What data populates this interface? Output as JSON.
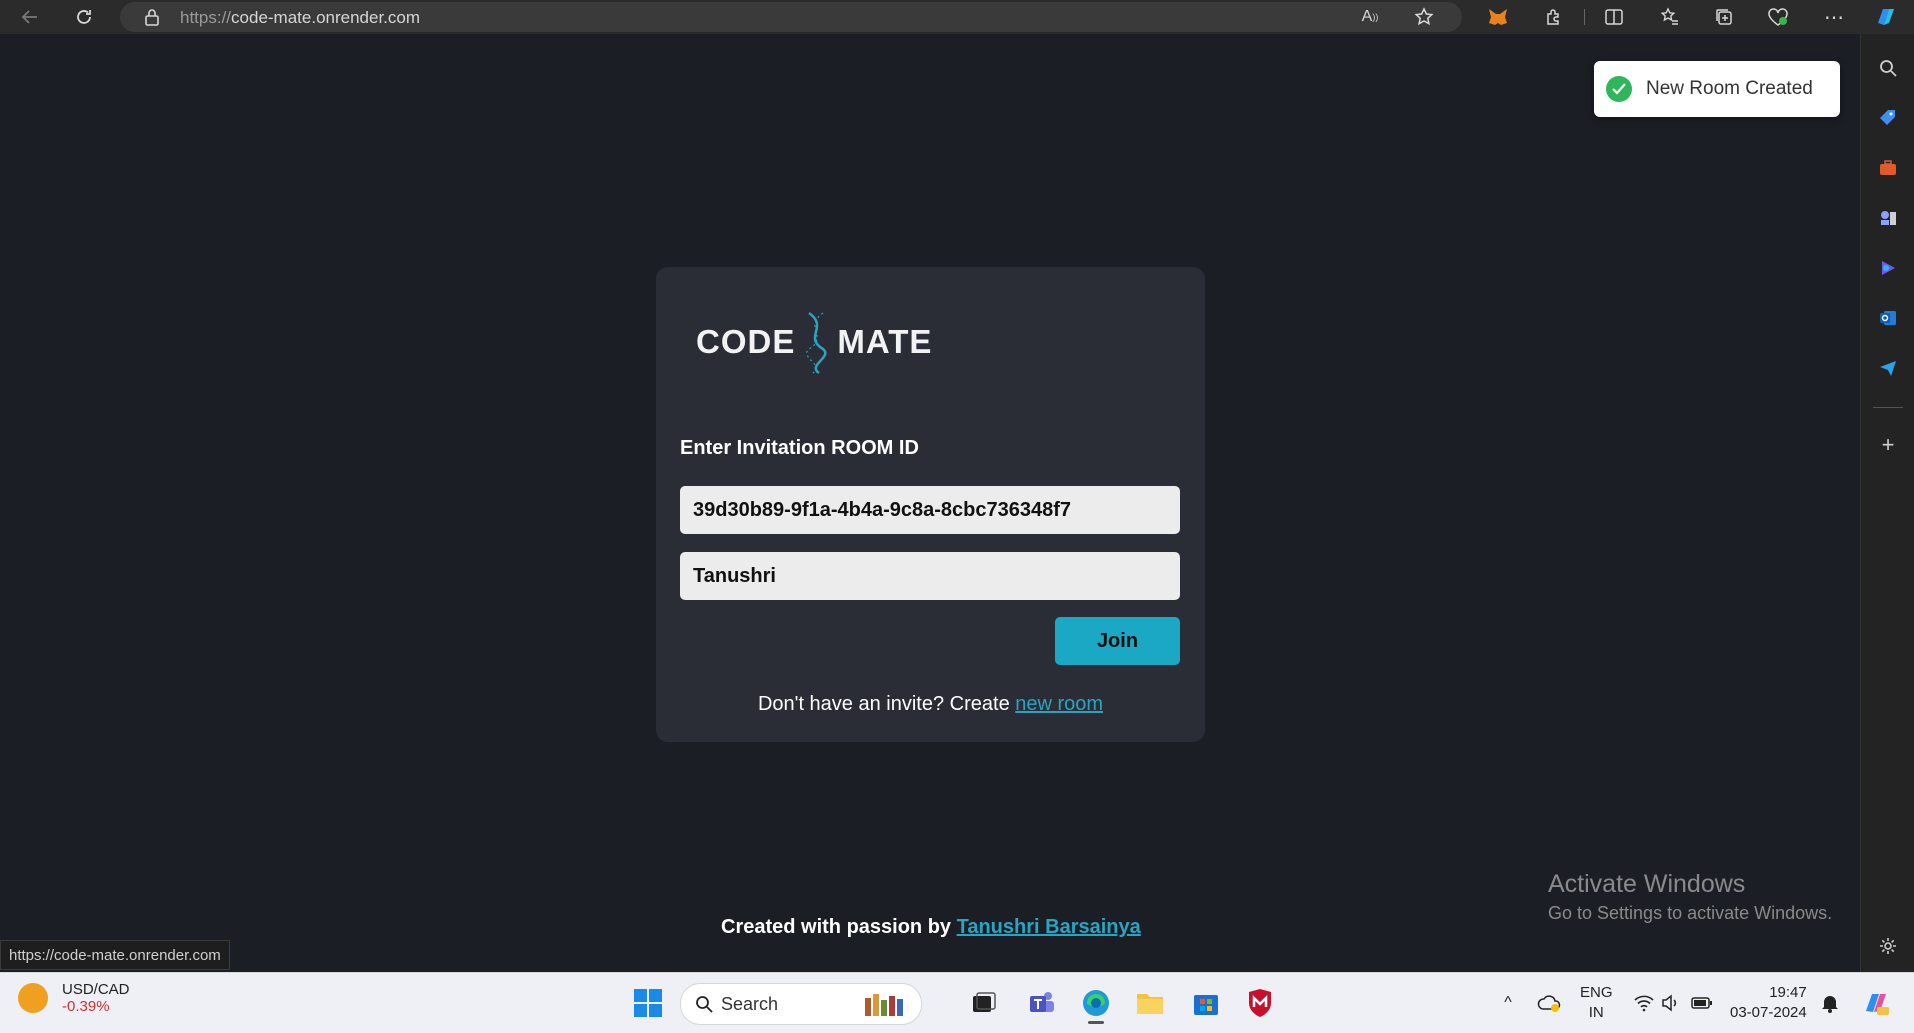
{
  "browser": {
    "url_prefix": "https://",
    "url_domain": "code-mate.onrender.com"
  },
  "toast": {
    "text": "New Room Created"
  },
  "card": {
    "logo_left": "CODE",
    "logo_right": "MATE",
    "label": "Enter Invitation ROOM ID",
    "room_id_value": "39d30b89-9f1a-4b4a-9c8a-8cbc736348f7",
    "username_value": "Tanushri",
    "join_label": "Join",
    "invite_text": "Don't have an invite? Create ",
    "invite_link": "new room"
  },
  "footer": {
    "text": "Created with passion by ",
    "author_link": " Tanushri Barsainya"
  },
  "activate": {
    "title": "Activate Windows",
    "subtitle": "Go to Settings to activate Windows."
  },
  "status_url": "https://code-mate.onrender.com",
  "taskbar": {
    "stock_name": "USD/CAD",
    "stock_change": "-0.39%",
    "search_label": "Search",
    "lang_1": "ENG",
    "lang_2": "IN",
    "time": "19:47",
    "date": "03-07-2024"
  },
  "colors": {
    "page_bg": "#1c1e26",
    "card_bg": "#2a2c36",
    "accent": "#1aa8c4",
    "link": "#2aa4c0",
    "toast_success": "#2fb65b"
  }
}
